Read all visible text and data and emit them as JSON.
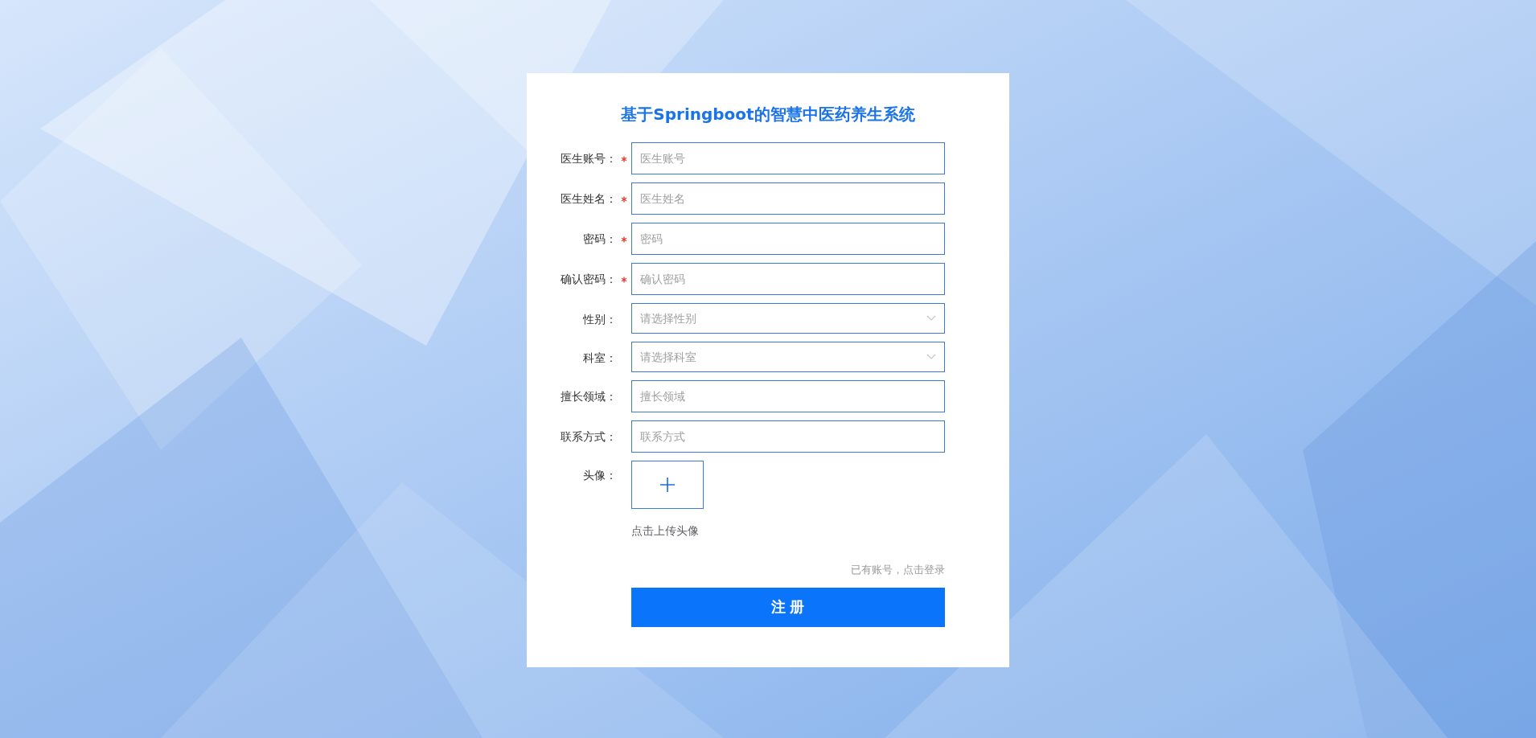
{
  "title": "基于Springboot的智慧中医药养生系统",
  "fields": [
    {
      "kind": "text",
      "label": "医生账号：",
      "required": true,
      "placeholder": "医生账号"
    },
    {
      "kind": "text",
      "label": "医生姓名：",
      "required": true,
      "placeholder": "医生姓名"
    },
    {
      "kind": "password",
      "label": "密码：",
      "required": true,
      "placeholder": "密码"
    },
    {
      "kind": "password",
      "label": "确认密码：",
      "required": true,
      "placeholder": "确认密码"
    },
    {
      "kind": "select",
      "label": "性别：",
      "required": false,
      "placeholder": "请选择性别"
    },
    {
      "kind": "select",
      "label": "科室：",
      "required": false,
      "placeholder": "请选择科室"
    },
    {
      "kind": "text",
      "label": "擅长领域：",
      "required": false,
      "placeholder": "擅长领域"
    },
    {
      "kind": "text",
      "label": "联系方式：",
      "required": false,
      "placeholder": "联系方式"
    },
    {
      "kind": "upload",
      "label": "头像：",
      "required": false,
      "hint": "点击上传头像"
    }
  ],
  "login_link": "已有账号，点击登录",
  "submit_button": "注 册"
}
